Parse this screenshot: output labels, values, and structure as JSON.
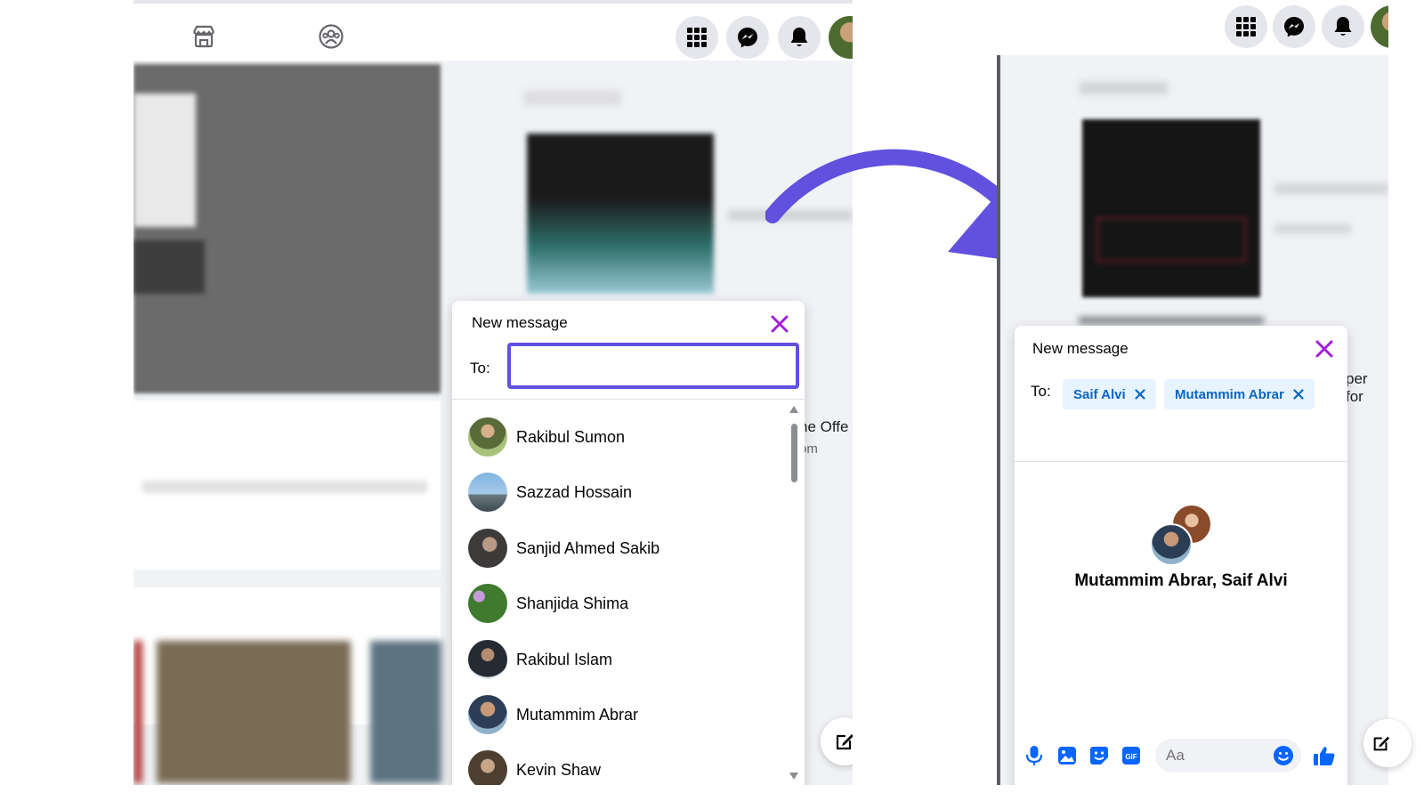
{
  "left_screen": {
    "new_message": {
      "title": "New message",
      "to_label": "To:",
      "to_value": ""
    },
    "contacts": [
      {
        "name": "Rakibul Sumon"
      },
      {
        "name": "Sazzad Hossain"
      },
      {
        "name": "Sanjid Ahmed Sakib"
      },
      {
        "name": "Shanjida Shima"
      },
      {
        "name": "Rakibul Islam"
      },
      {
        "name": "Mutammim Abrar"
      },
      {
        "name": "Kevin Shaw"
      }
    ],
    "peek_text_1": "ne Offe",
    "peek_text_2": "om"
  },
  "right_screen": {
    "new_message": {
      "title": "New message",
      "to_label": "To:"
    },
    "recipients": [
      {
        "name": "Saif Alvi"
      },
      {
        "name": "Mutammim Abrar"
      }
    ],
    "group_name": "Mutammim Abrar, Saif Alvi",
    "composer_placeholder": "Aa",
    "peek_text": "per for"
  },
  "colors": {
    "accent_purple": "#6151de",
    "close_x": "#a020d8",
    "messenger_blue": "#0866ff",
    "chip_bg": "#e7f3ff",
    "chip_text": "#0a66c2",
    "feed_bg": "#f0f2f5"
  },
  "icons": {
    "marketplace": "marketplace-icon",
    "groups": "groups-icon",
    "menu": "grid-menu-icon",
    "messenger": "messenger-icon",
    "notifications": "bell-icon",
    "close": "close-icon",
    "compose": "compose-icon",
    "microphone": "microphone-icon",
    "photo": "photo-icon",
    "sticker": "sticker-icon",
    "gif": "gif-icon",
    "emoji": "emoji-icon",
    "like": "thumbs-up-icon"
  }
}
